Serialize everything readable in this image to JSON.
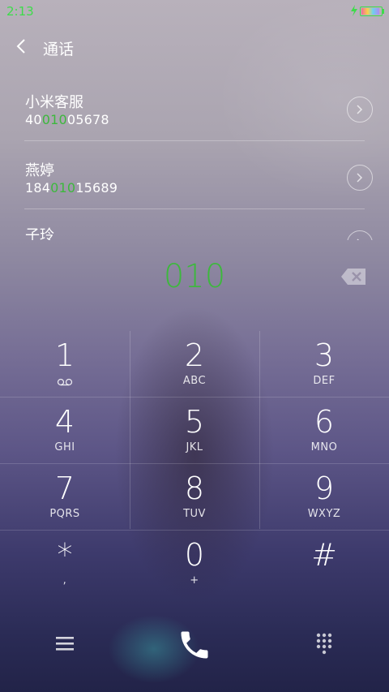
{
  "status_bar": {
    "time": "2:13",
    "icons": [
      "charging-icon",
      "battery-icon"
    ]
  },
  "header": {
    "title": "通话",
    "icon": "back-arrow-icon"
  },
  "contacts": [
    {
      "name": "小米客服",
      "number_pre": "40",
      "number_match": "010",
      "number_post": "05678"
    },
    {
      "name": "燕婷",
      "number_pre": "184",
      "number_match": "010",
      "number_post": "15689"
    },
    {
      "name": "子玲",
      "number_pre": "",
      "number_match": "",
      "number_post": ""
    }
  ],
  "dialer": {
    "input": "010",
    "delete_icon": "backspace-icon"
  },
  "keypad": [
    {
      "digit": "1",
      "letters": "",
      "icon": "voicemail-icon"
    },
    {
      "digit": "2",
      "letters": "ABC"
    },
    {
      "digit": "3",
      "letters": "DEF"
    },
    {
      "digit": "4",
      "letters": "GHI"
    },
    {
      "digit": "5",
      "letters": "JKL"
    },
    {
      "digit": "6",
      "letters": "MNO"
    },
    {
      "digit": "7",
      "letters": "PQRS"
    },
    {
      "digit": "8",
      "letters": "TUV"
    },
    {
      "digit": "9",
      "letters": "WXYZ"
    },
    {
      "digit": "*",
      "letters": ","
    },
    {
      "digit": "0",
      "letters": "+"
    },
    {
      "digit": "#",
      "letters": ""
    }
  ],
  "bottom_bar": {
    "icons": [
      "menu-icon",
      "phone-call-icon",
      "dialpad-icon"
    ]
  },
  "colors": {
    "accent_green": "#3db83d",
    "status_green": "#3ddc4a"
  }
}
